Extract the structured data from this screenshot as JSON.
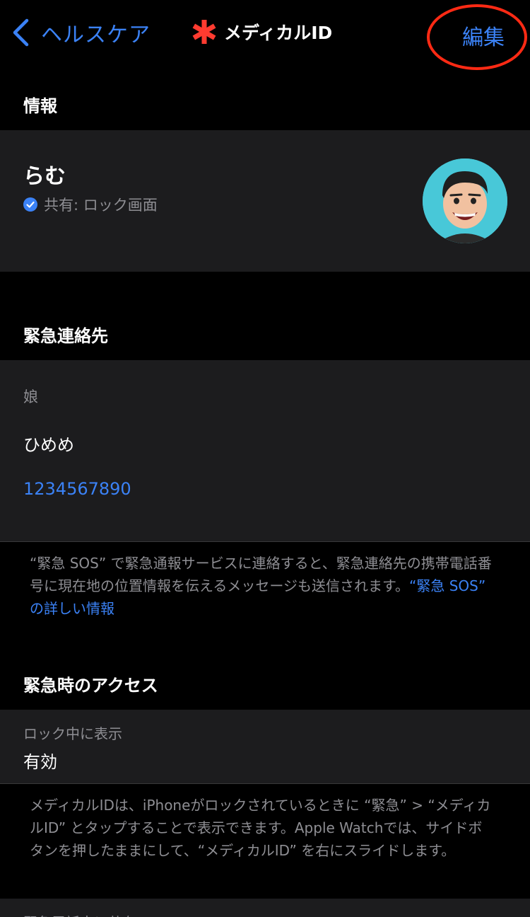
{
  "nav": {
    "back_label": "ヘルスケア",
    "title": "メディカルID",
    "edit_label": "編集"
  },
  "colors": {
    "accent": "#3b82f6",
    "title_asterisk": "#ff3b30",
    "highlight_circle": "#ff2a14",
    "background": "#000000",
    "panel": "#1c1c1e",
    "secondary_text": "#8e8e93"
  },
  "info_section": {
    "header": "情報",
    "name": "らむ",
    "shared_status": "共有: ロック画面",
    "shared_icon": "checkmark-circle-icon",
    "avatar_icon": "memoji-avatar"
  },
  "emergency_contacts": {
    "header": "緊急連絡先",
    "contact": {
      "relationship": "娘",
      "name": "ひめめ",
      "phone": "1234567890"
    },
    "footnote_text": "“緊急 SOS” で緊急通報サービスに連絡すると、緊急連絡先の携帯電話番号に現在地の位置情報を伝えるメッセージも送信されます。",
    "footnote_link": "“緊急 SOS” の詳しい情報"
  },
  "emergency_access": {
    "header": "緊急時のアクセス",
    "show_when_locked_label": "ロック中に表示",
    "show_when_locked_value": "有効",
    "footnote": "メディカルIDは、iPhoneがロックされているときに “緊急” > “メディカルID” とタップすることで表示できます。Apple Watchでは、サイドボタンを押したままにして、“メディカルID” を右にスライドします。",
    "partial_row_label": "緊急電話中に共有"
  }
}
